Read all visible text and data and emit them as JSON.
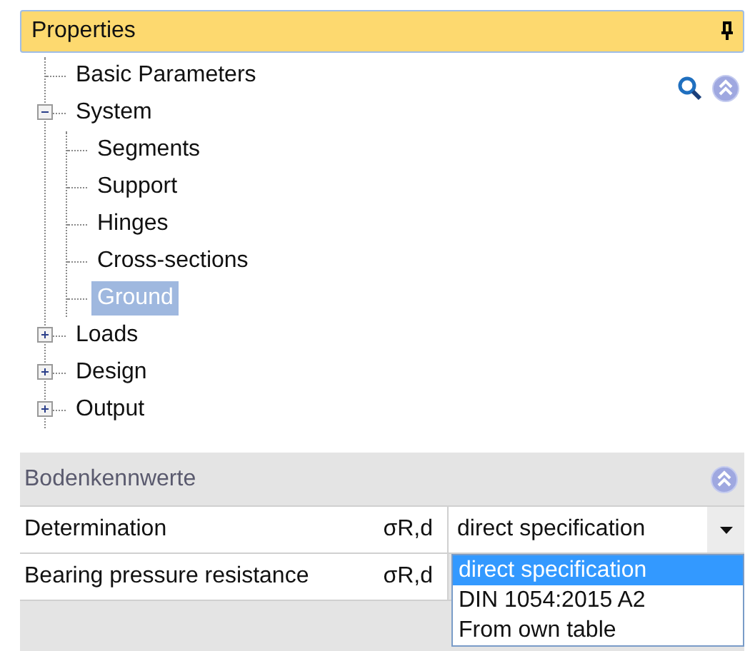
{
  "panel": {
    "title": "Properties"
  },
  "tree": [
    {
      "label": "Basic Parameters",
      "selected": false
    },
    {
      "label": "System",
      "selected": false,
      "expanded": true,
      "children": [
        {
          "label": "Segments",
          "selected": false
        },
        {
          "label": "Support",
          "selected": false
        },
        {
          "label": "Hinges",
          "selected": false
        },
        {
          "label": "Cross-sections",
          "selected": false
        },
        {
          "label": "Ground",
          "selected": true
        }
      ]
    },
    {
      "label": "Loads",
      "selected": false,
      "expanded": false
    },
    {
      "label": "Design",
      "selected": false,
      "expanded": false
    },
    {
      "label": "Output",
      "selected": false,
      "expanded": false
    }
  ],
  "section": {
    "title": "Bodenkennwerte",
    "expanded": true
  },
  "properties": [
    {
      "kind": "dropdown",
      "label": "Determination",
      "symbol": "σR,d",
      "value": "direct specification",
      "open": true,
      "options": [
        {
          "label": "direct specification",
          "selected": true
        },
        {
          "label": "DIN 1054:2015 A2",
          "selected": false
        },
        {
          "label": "From own table",
          "selected": false
        }
      ]
    },
    {
      "kind": "text",
      "label": "Bearing pressure resistance",
      "symbol": "σR,d"
    }
  ]
}
